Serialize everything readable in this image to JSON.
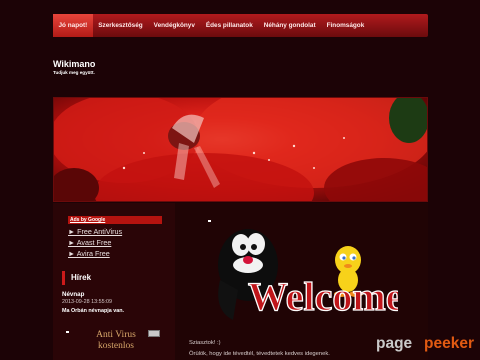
{
  "nav": {
    "items": [
      "Jó napot!",
      "Szerkesztőség",
      "Vendégkönyv",
      "Édes pillanatok",
      "Néhány gondolat",
      "Finomságok"
    ],
    "active_index": 0
  },
  "site": {
    "title": "Wikimano",
    "subtitle": "Tudjuk meg együtt."
  },
  "sidebar": {
    "ads_heading": "Ads by Google",
    "ad_links": [
      "► Free AntiVirus",
      "► Avast Free",
      "► Avira Free"
    ],
    "news_heading": "Hírek",
    "nameday_title": "Névnap",
    "nameday_date": "2013-09-28 13:55:09",
    "nameday_text": "Ma Orbán névnapja van.",
    "antivirus_ad": "Anti Virus\nkostenlos"
  },
  "main": {
    "welcome_image_text": "Welcome",
    "line1": "Sziasztok! :)",
    "line2": "Örülök, hogy ide tévedtél, tévedtetek kedves idegenek."
  },
  "watermark": {
    "part1": "page",
    "part2": "peeker"
  },
  "colors": {
    "background": "#1c0306",
    "nav_red": "#b01a1d",
    "accent_orange": "#e15a12"
  }
}
